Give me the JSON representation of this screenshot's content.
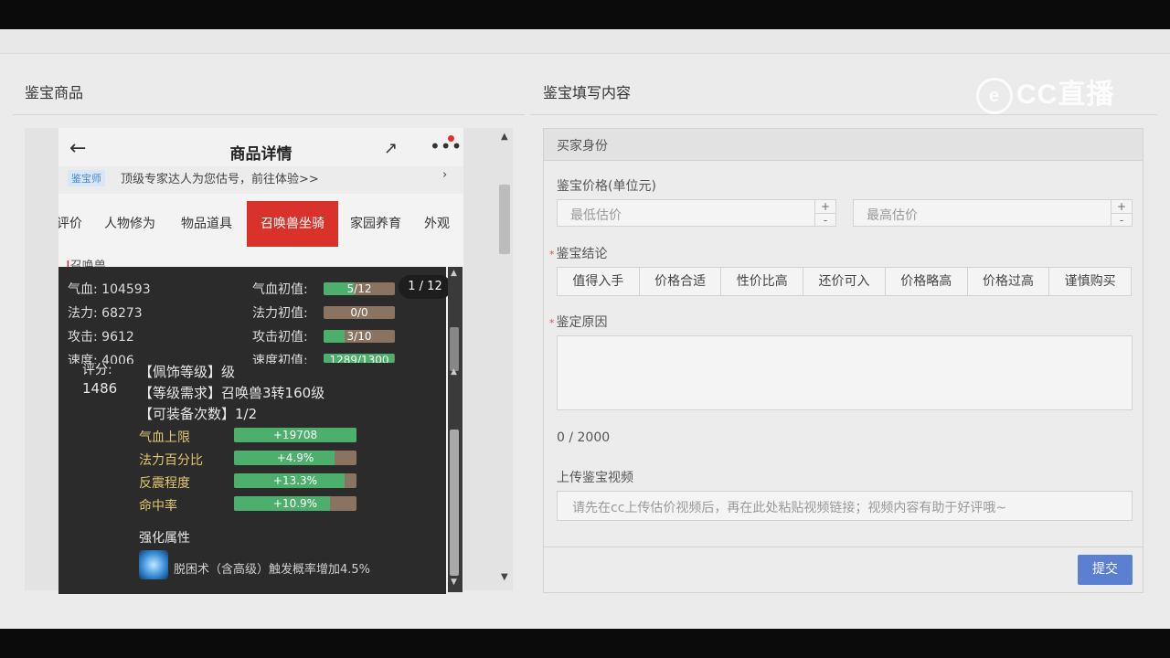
{
  "left_section": {
    "title": "鉴宝商品"
  },
  "right_section": {
    "title": "鉴宝填写内容"
  },
  "watermark": {
    "text": "CC直播"
  },
  "phone": {
    "header_title": "商品详情",
    "back_icon": "arrow-left-icon",
    "share_icon": "share-icon",
    "more_icon": "more-dots-icon",
    "banner_tag": "鉴宝师",
    "banner_text": "顶级专家达人为您估号，前往体验>>",
    "banner_arrow": "›",
    "tabs": [
      "评价",
      "人物修为",
      "物品道具",
      "召唤兽坐骑",
      "家园养育",
      "外观"
    ],
    "active_tab": "召唤兽坐骑",
    "sub_heading": "召唤兽"
  },
  "popup": {
    "counter": "1 / 12",
    "stats": [
      {
        "label": "气血:",
        "value": "104593",
        "init_label": "气血初值:",
        "init_value": "5/12",
        "ratio": 0.42
      },
      {
        "label": "法力:",
        "value": "68273",
        "init_label": "法力初值:",
        "init_value": "0/0",
        "ratio": 0
      },
      {
        "label": "攻击:",
        "value": "9612",
        "init_label": "攻击初值:",
        "init_value": "3/10",
        "ratio": 0.3
      },
      {
        "label": "速度:",
        "value": "4006",
        "init_label": "速度初值:",
        "init_value": "1289/1300",
        "ratio": 0.99
      }
    ],
    "score_label": "评分:",
    "score_value": "1486",
    "equip_lines": [
      "【佩饰等级】级",
      "【等级需求】召唤兽3转160级",
      "【可装备次数】1/2"
    ],
    "attributes": [
      {
        "name": "气血上限",
        "value": "+19708",
        "ratio": 1.0
      },
      {
        "name": "法力百分比",
        "value": "+4.9%",
        "ratio": 0.82
      },
      {
        "name": "反震程度",
        "value": "+13.3%",
        "ratio": 0.9
      },
      {
        "name": "命中率",
        "value": "+10.9%",
        "ratio": 0.78
      }
    ],
    "enhance_title": "强化属性",
    "skill_icon": "skill-crystal-icon",
    "skill_text": "脱困术（含高级）触发概率增加4.5%"
  },
  "form": {
    "buyer_identity": "买家身份",
    "price_label": "鉴宝价格(单位元)",
    "min_placeholder": "最低估价",
    "max_placeholder": "最高估价",
    "plus": "+",
    "minus": "-",
    "conclusion_label": "鉴宝结论",
    "conclusions": [
      "值得入手",
      "价格合适",
      "性价比高",
      "还价可入",
      "价格略高",
      "价格过高",
      "谨慎购买"
    ],
    "reason_label": "鉴定原因",
    "reason_count": "0 / 2000",
    "video_label": "上传鉴宝视频",
    "video_placeholder": "请先在cc上传估价视频后，再在此处粘贴视频链接；视频内容有助于好评哦~",
    "submit_label": "提交"
  }
}
